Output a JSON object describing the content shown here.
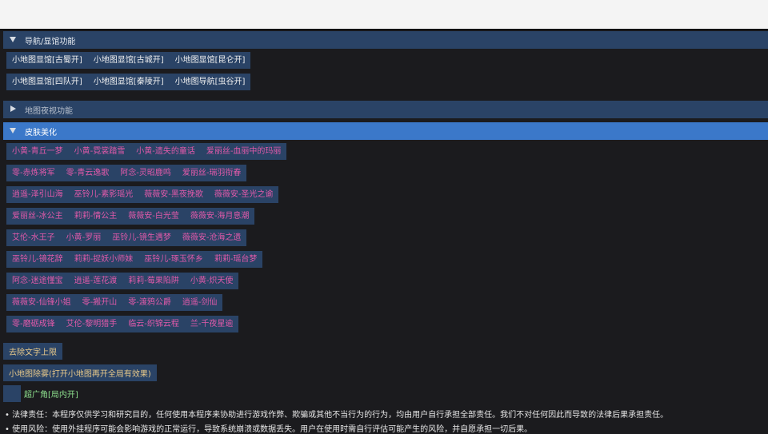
{
  "sections": {
    "nav": {
      "title": "导航/显馆功能",
      "rows": [
        [
          "小地图显馆[古蜀开]",
          "小地图显馆[古城开]",
          "小地图显馆[昆仑开]"
        ],
        [
          "小地图显馆[四队开]",
          "小地图显馆[秦陵开]",
          "小地图导航[虫谷开]"
        ]
      ]
    },
    "night": {
      "title": "地图夜视功能"
    },
    "skin": {
      "title": "皮肤美化",
      "rows": [
        [
          "小黄-青丘一梦",
          "小黄-霓裳踏雪",
          "小黄-遗失的童话",
          "爱丽丝-血丽中的玛丽"
        ],
        [
          "零-赤炼将军",
          "零-青云逸歌",
          "阿念-灵昭鹿鸣",
          "爱丽丝-瑞羽衔春"
        ],
        [
          "逍遥-泽引山海",
          "巫铃儿-素影瑶光",
          "薇薇安-黑夜挽歌",
          "薇薇安-圣光之谕"
        ],
        [
          "爱丽丝-冰公主",
          "莉莉-情公主",
          "薇薇安-白光莹",
          "薇薇安-海月息潮"
        ],
        [
          "艾伦-水王子",
          "小黄-罗丽",
          "巫铃儿-镜生遇梦",
          "薇薇安-沧海之遗"
        ],
        [
          "巫铃儿-镜花辞",
          "莉莉-捉妖小师妹",
          "巫铃儿-琢玉怀乡",
          "莉莉-瑶台梦"
        ],
        [
          "阿念-迷途懂宝",
          "逍遥-莲花渡",
          "莉莉-莓果陷阱",
          "小黄-炽天使"
        ],
        [
          "薇薇安-仙锋小姐",
          "零-搬开山",
          "零-渡鸦公爵",
          "逍遥-剑仙"
        ],
        [
          "零-磨砺成锋",
          "艾伦-黎明猎手",
          "临云-织锦云程",
          "兰-千夜星逾"
        ]
      ]
    }
  },
  "buttons": {
    "remove_text_limit": "去除文字上限",
    "minimap_defog": "小地图除雾(打开小地图再开全局有效果)"
  },
  "checkbox": {
    "label": "超广角[局内开]"
  },
  "notices": [
    "• 法律责任：本程序仅供学习和研究目的，任何使用本程序来协助进行游戏作弊、欺骗或其他不当行为的行为，均由用户自行承担全部责任。我们不对任何因此而导致的法律后果承担责任。",
    "• 使用风险：使用外挂程序可能会影响游戏的正常运行，导致系统崩溃或数据丢失。用户在使用时需自行评估可能产生的风险，并自愿承担一切后果。"
  ],
  "colors": {
    "header": "#2a4366",
    "header_active": "#3b78c9",
    "skin_text": "#e25aaa",
    "single_button_text": "#e8c98a",
    "checkbox_label": "#8ee08e"
  }
}
